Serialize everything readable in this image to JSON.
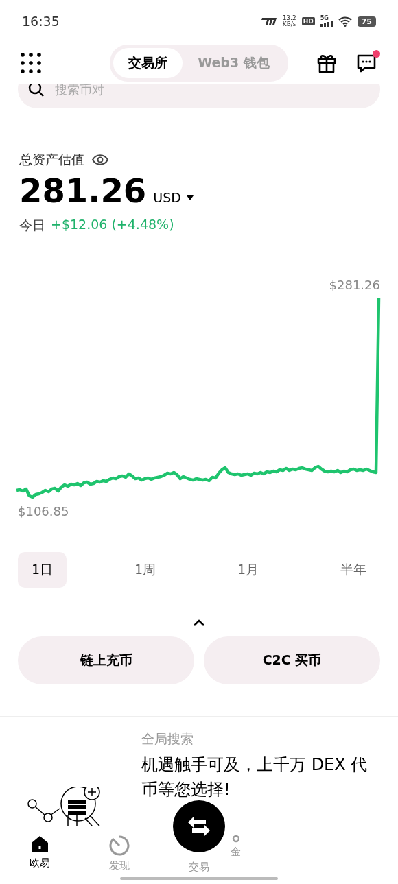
{
  "status_bar": {
    "time": "16:35",
    "speed_value": "13.2",
    "speed_unit": "KB/s",
    "hd": "HD",
    "network": "5G",
    "battery": "75"
  },
  "header": {
    "tabs": [
      {
        "label": "交易所",
        "selected": true
      },
      {
        "label": "Web3 钱包",
        "selected": false
      }
    ],
    "message_badge": true
  },
  "search": {
    "placeholder": "搜索币对"
  },
  "assets": {
    "title": "总资产估值",
    "amount": "281.26",
    "currency": "USD",
    "today_label": "今日",
    "today_change": "+$12.06 (+4.48%)"
  },
  "chart": {
    "max_label": "$281.26",
    "min_label": "$106.85"
  },
  "ranges": [
    {
      "label": "1日",
      "selected": true
    },
    {
      "label": "1周",
      "selected": false
    },
    {
      "label": "1月",
      "selected": false
    },
    {
      "label": "半年",
      "selected": false
    }
  ],
  "actions": [
    {
      "label": "链上充币"
    },
    {
      "label": "C2C 买币"
    }
  ],
  "promo": {
    "subtitle": "全局搜索",
    "text": "机遇触手可及，上千万 DEX 代币等您选择!"
  },
  "nav": [
    {
      "label": "欧易",
      "kind": "home",
      "selected": true
    },
    {
      "label": "发现",
      "kind": "discover",
      "selected": false
    },
    {
      "label": "交易",
      "kind": "trade",
      "selected": false
    },
    {
      "label": "金",
      "kind": "partial",
      "selected": false
    }
  ]
}
